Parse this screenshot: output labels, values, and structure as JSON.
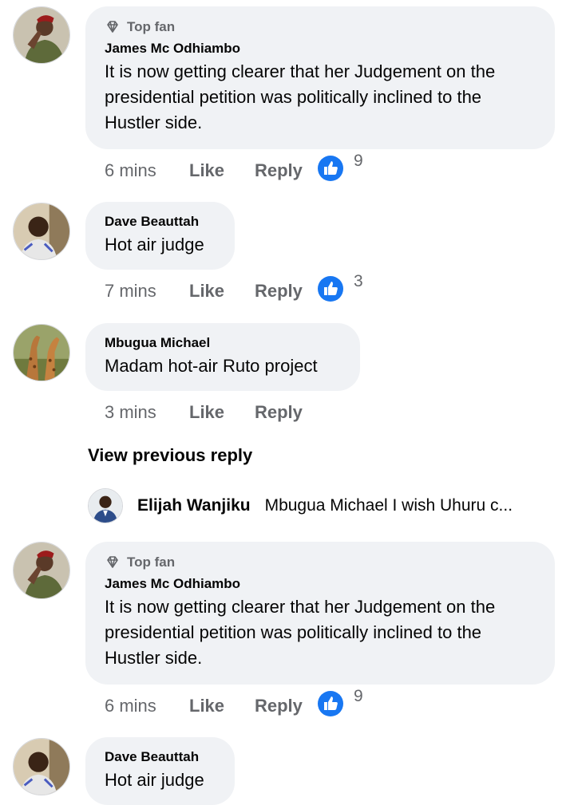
{
  "colors": {
    "bubble": "#f0f2f5",
    "meta": "#65676b",
    "like_blue": "#1877f2"
  },
  "comments": [
    {
      "badge": "Top fan",
      "badge_icon": "diamond-icon",
      "author": "James Mc Odhiambo",
      "lines": [
        "It is now getting clearer that her Judgement on the",
        "presidential petition was politically inclined to the",
        "Hustler side."
      ],
      "time": "6 mins",
      "like": "Like",
      "reply": "Reply",
      "reactions": "9"
    },
    {
      "author": "Dave Beauttah",
      "lines": [
        "Hot air judge"
      ],
      "time": "7 mins",
      "like": "Like",
      "reply": "Reply",
      "reactions": "3"
    },
    {
      "author": "Mbugua Michael",
      "lines": [
        "Madam hot-air Ruto project"
      ],
      "time": "3 mins",
      "like": "Like",
      "reply": "Reply"
    },
    {
      "badge": "Top fan",
      "badge_icon": "diamond-icon",
      "author": "James Mc Odhiambo",
      "lines": [
        "It is now getting clearer that her Judgement on the",
        "presidential petition was politically inclined to the",
        "Hustler side."
      ],
      "time": "6 mins",
      "like": "Like",
      "reply": "Reply",
      "reactions": "9"
    },
    {
      "author": "Dave Beauttah",
      "lines": [
        "Hot air judge"
      ]
    }
  ],
  "view_previous": "View previous reply",
  "reply_preview": {
    "author": "Elijah Wanjiku",
    "text": "Mbugua Michael I wish Uhuru c..."
  }
}
